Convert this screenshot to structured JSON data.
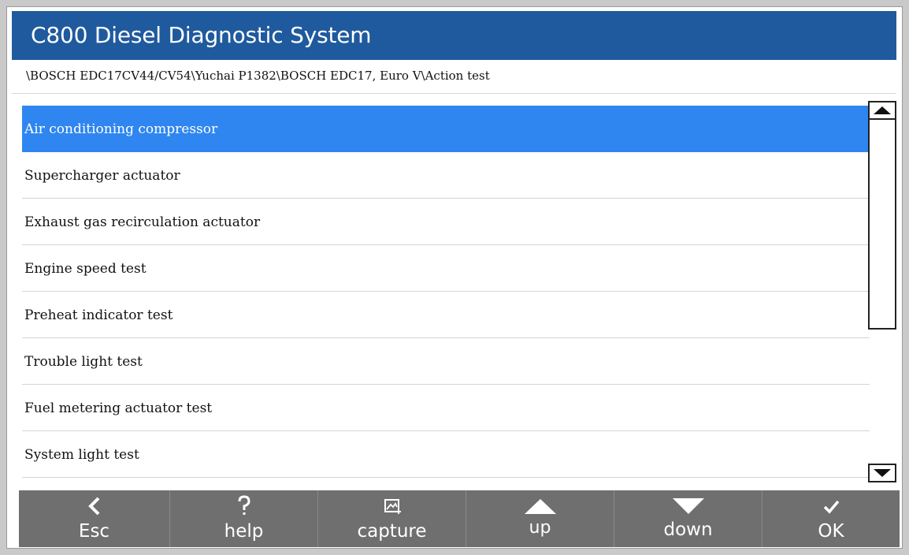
{
  "app": {
    "title": "C800 Diesel Diagnostic System"
  },
  "path": "\\BOSCH EDC17CV44/CV54\\Yuchai P1382\\BOSCH EDC17, Euro V\\Action test",
  "list": {
    "items": [
      {
        "label": "Air conditioning compressor",
        "selected": true
      },
      {
        "label": "Supercharger actuator"
      },
      {
        "label": "Exhaust gas recirculation actuator"
      },
      {
        "label": "Engine speed test"
      },
      {
        "label": "Preheat indicator test"
      },
      {
        "label": "Trouble light test"
      },
      {
        "label": "Fuel metering actuator test"
      },
      {
        "label": "System light test"
      }
    ]
  },
  "toolbar": {
    "esc_label": "Esc",
    "help_label": "help",
    "capture_label": "capture",
    "up_label": "up",
    "down_label": "down",
    "ok_label": "OK"
  },
  "icons": {
    "esc": "chevron-left-icon",
    "help": "question-mark-icon",
    "capture": "camera-capture-icon",
    "up": "triangle-up-icon",
    "down": "triangle-down-icon",
    "ok": "checkmark-icon"
  },
  "colors": {
    "title_bar": "#1f5a9e",
    "selected_row": "#2f86f0",
    "toolbar": "#6f6f6f"
  }
}
